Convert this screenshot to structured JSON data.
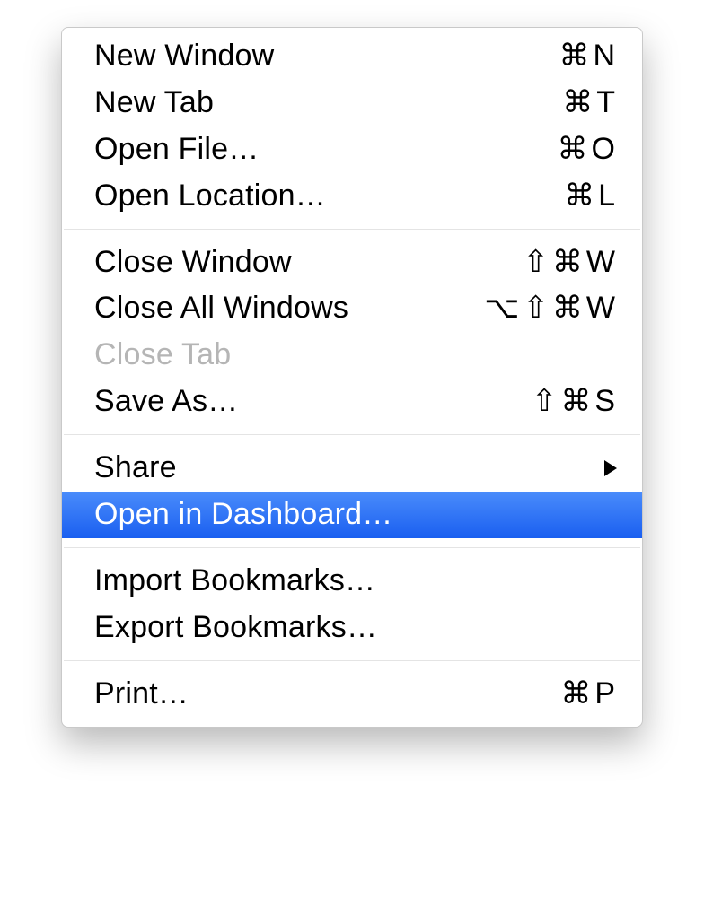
{
  "menu": {
    "groups": [
      [
        {
          "id": "new-window",
          "label": "New Window",
          "shortcut": "⌘N"
        },
        {
          "id": "new-tab",
          "label": "New Tab",
          "shortcut": "⌘T"
        },
        {
          "id": "open-file",
          "label": "Open File…",
          "shortcut": "⌘O"
        },
        {
          "id": "open-location",
          "label": "Open Location…",
          "shortcut": "⌘L"
        }
      ],
      [
        {
          "id": "close-window",
          "label": "Close Window",
          "shortcut": "⇧⌘W"
        },
        {
          "id": "close-all-windows",
          "label": "Close All Windows",
          "shortcut": "⌥⇧⌘W"
        },
        {
          "id": "close-tab",
          "label": "Close Tab",
          "shortcut": "",
          "disabled": true
        },
        {
          "id": "save-as",
          "label": "Save As…",
          "shortcut": "⇧⌘S"
        }
      ],
      [
        {
          "id": "share",
          "label": "Share",
          "shortcut": "",
          "submenu": true
        },
        {
          "id": "open-in-dashboard",
          "label": "Open in Dashboard…",
          "shortcut": "",
          "highlighted": true
        }
      ],
      [
        {
          "id": "import-bookmarks",
          "label": "Import Bookmarks…",
          "shortcut": ""
        },
        {
          "id": "export-bookmarks",
          "label": "Export Bookmarks…",
          "shortcut": ""
        }
      ],
      [
        {
          "id": "print",
          "label": "Print…",
          "shortcut": "⌘P"
        }
      ]
    ]
  }
}
